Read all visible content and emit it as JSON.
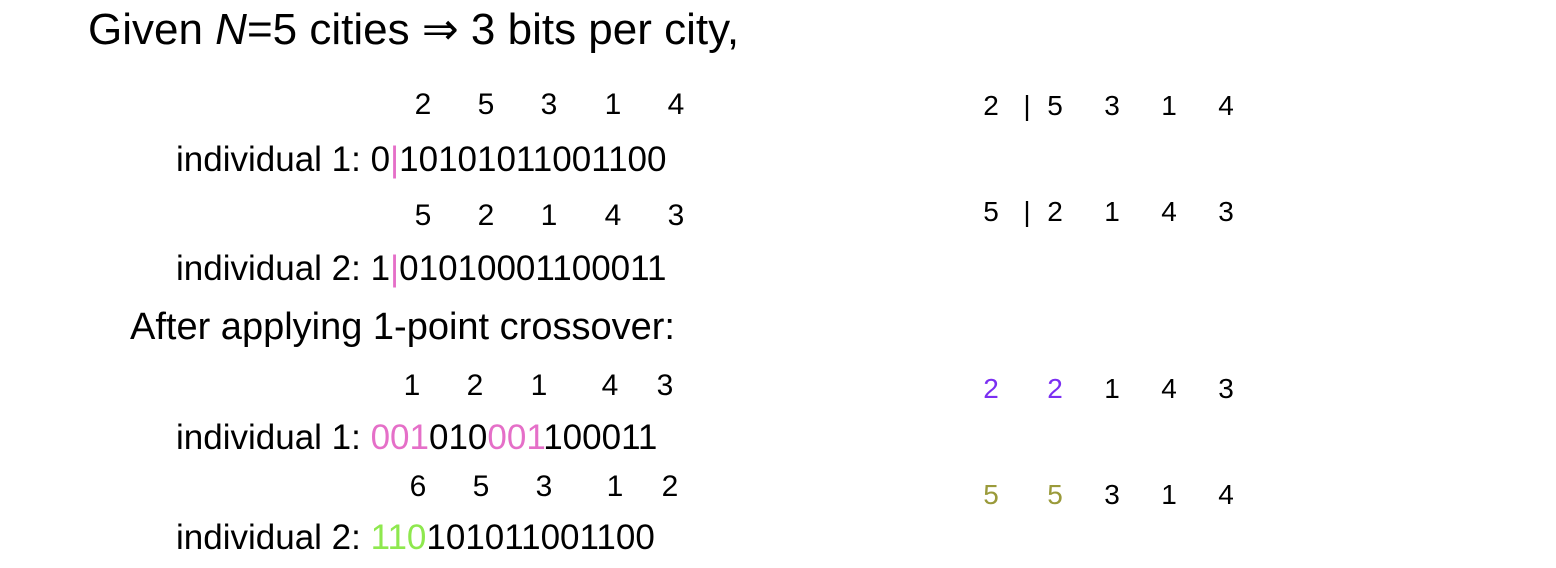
{
  "title": {
    "prefix": "Given ",
    "var": "N",
    "suffix": "=5 cities ⇒ 3 bits per city,"
  },
  "before": {
    "ind1": {
      "cities": [
        "2",
        "5",
        "3",
        "1",
        "4"
      ],
      "label": "individual 1: ",
      "bits_a": "0",
      "sep": "|",
      "bits_b": "10101011001100"
    },
    "ind2": {
      "cities": [
        "5",
        "2",
        "1",
        "4",
        "3"
      ],
      "label": "individual 2: ",
      "bits_a": "1",
      "sep": "|",
      "bits_b": "01010001100011"
    }
  },
  "subtitle": "After applying 1-point crossover:",
  "after": {
    "ind1": {
      "cities": [
        "1",
        "2",
        "1",
        "4",
        "3"
      ],
      "label": "individual 1: ",
      "seg": [
        "001",
        "010",
        "001",
        "100011"
      ]
    },
    "ind2": {
      "cities": [
        "6",
        "5",
        "3",
        "1",
        "2"
      ],
      "label": "individual 2: ",
      "seg": [
        "110",
        "101011001100"
      ]
    }
  },
  "right": {
    "row1": [
      "2",
      "|",
      "5",
      "3",
      "1",
      "4"
    ],
    "row2": [
      "5",
      "|",
      "2",
      "1",
      "4",
      "3"
    ],
    "row3": [
      "2",
      "2",
      "1",
      "4",
      "3"
    ],
    "row4": [
      "5",
      "5",
      "3",
      "1",
      "4"
    ]
  },
  "colors": {
    "pink": "#e56fc8",
    "green": "#8ee84e",
    "purple": "#7b2ff2",
    "olive": "#9a9a3a"
  }
}
